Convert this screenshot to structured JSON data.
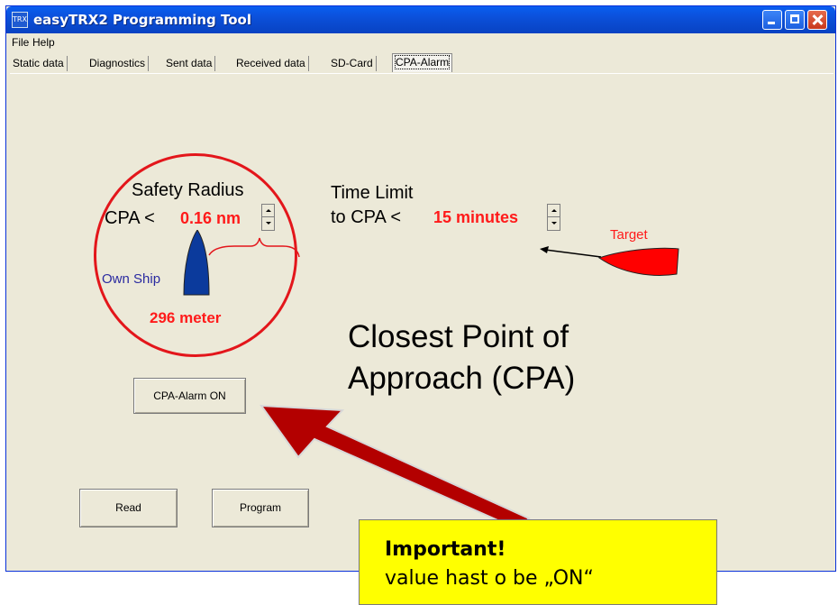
{
  "window": {
    "title": "easyTRX2 Programming Tool",
    "icon_text": "TRX"
  },
  "menu": [
    "File",
    "Help"
  ],
  "tabs": [
    "Static data",
    "Diagnostics",
    "Sent data",
    "Received data",
    "SD-Card",
    "CPA-Alarm"
  ],
  "active_tab": "CPA-Alarm",
  "cpa": {
    "safety_radius_label": "Safety Radius",
    "cpa_prefix": "CPA  <",
    "cpa_value": "0.16 nm",
    "meter_value": "296 meter",
    "own_ship_label": "Own Ship",
    "time_limit_label": "Time Limit",
    "to_cpa_prefix": "to CPA  <",
    "time_value": "15 minutes",
    "target_label": "Target",
    "big_title_line1": "Closest Point of",
    "big_title_line2": "Approach (CPA)"
  },
  "buttons": {
    "alarm": "CPA-Alarm ON",
    "read": "Read",
    "program": "Program"
  },
  "callout": {
    "title": "Important!",
    "text": "value hast o be „ON“"
  },
  "colors": {
    "accent_red": "#ff1a1a",
    "ship_blue": "#0b3a9c",
    "callout_yellow": "#ffff00",
    "arrow_red": "#b30000"
  }
}
